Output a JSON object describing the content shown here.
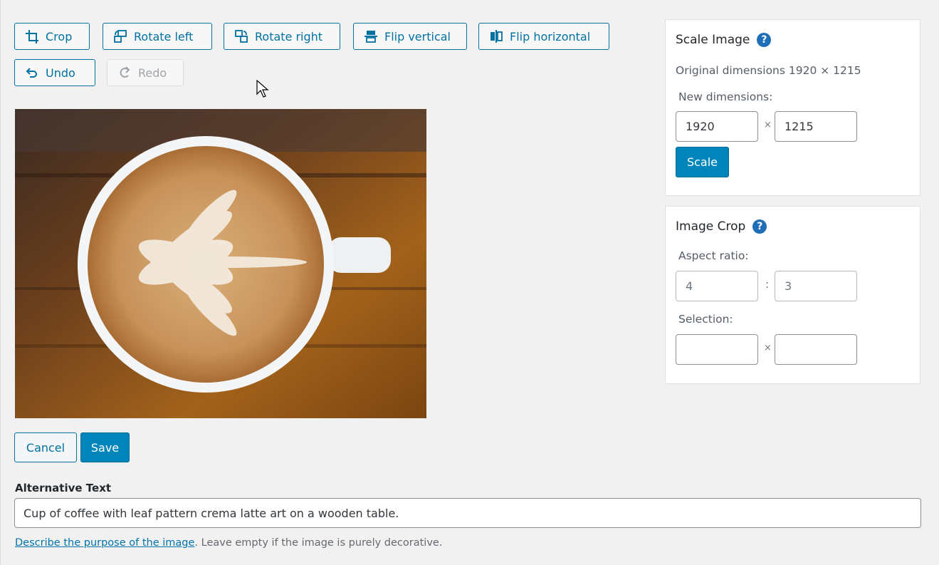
{
  "toolbar": {
    "crop": "Crop",
    "rotate_left": "Rotate left",
    "rotate_right": "Rotate right",
    "flip_vertical": "Flip vertical",
    "flip_horizontal": "Flip horizontal",
    "undo": "Undo",
    "redo": "Redo"
  },
  "actions": {
    "cancel": "Cancel",
    "save": "Save"
  },
  "alt_text": {
    "label": "Alternative Text",
    "value": "Cup of coffee with leaf pattern crema latte art on a wooden table.",
    "help_link": "Describe the purpose of the image",
    "help_rest": ". Leave empty if the image is purely decorative."
  },
  "scale_panel": {
    "title": "Scale Image",
    "help": "?",
    "original_dimensions": "Original dimensions 1920 × 1215",
    "new_dimensions_label": "New dimensions:",
    "width": "1920",
    "separator": "×",
    "height": "1215",
    "scale_button": "Scale"
  },
  "crop_panel": {
    "title": "Image Crop",
    "help": "?",
    "aspect_label": "Aspect ratio:",
    "aspect_w": "4",
    "aspect_separator": ":",
    "aspect_h": "3",
    "selection_label": "Selection:",
    "selection_w": "",
    "selection_separator": "×",
    "selection_h": ""
  },
  "colors": {
    "accent": "#0071a1",
    "primary": "#0085ba",
    "background": "#f1f1f1"
  },
  "icons": [
    "crop-icon",
    "rotate-left-icon",
    "rotate-right-icon",
    "flip-vertical-icon",
    "flip-horizontal-icon",
    "undo-icon",
    "redo-icon",
    "help-icon"
  ]
}
